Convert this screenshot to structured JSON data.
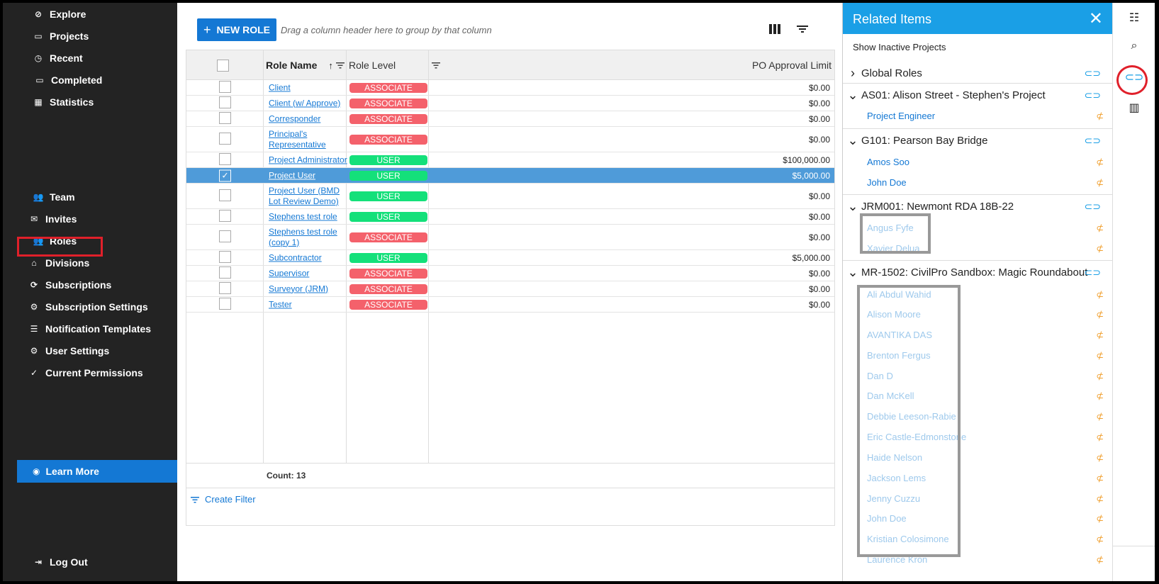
{
  "sidebar": {
    "top_items": [
      {
        "label": "Explore",
        "icon": "compass-icon"
      },
      {
        "label": "Projects",
        "icon": "folder-icon"
      },
      {
        "label": "Recent",
        "icon": "clock-icon"
      },
      {
        "label": "Completed",
        "icon": "inbox-icon"
      },
      {
        "label": "Statistics",
        "icon": "chart-icon"
      }
    ],
    "admin_items": [
      {
        "label": "Team",
        "icon": "team-icon"
      },
      {
        "label": "Invites",
        "icon": "envelope-icon"
      },
      {
        "label": "Roles",
        "icon": "roles-icon"
      },
      {
        "label": "Divisions",
        "icon": "home-icon"
      },
      {
        "label": "Subscriptions",
        "icon": "sync-icon"
      },
      {
        "label": "Subscription Settings",
        "icon": "gear-icon"
      },
      {
        "label": "Notification Templates",
        "icon": "list-icon"
      },
      {
        "label": "User Settings",
        "icon": "gear-icon"
      },
      {
        "label": "Current Permissions",
        "icon": "check-icon"
      }
    ],
    "learn_more": "Learn More",
    "log_out": "Log Out"
  },
  "toolbar": {
    "new_role": "NEW ROLE",
    "group_hint": "Drag a column header here to group by that column"
  },
  "grid": {
    "columns": {
      "role_name": "Role Name",
      "role_level": "Role Level",
      "po_limit": "PO Approval Limit"
    },
    "rows": [
      {
        "name": "Client",
        "level": "ASSOCIATE",
        "limit": "$0.00",
        "selected": false
      },
      {
        "name": "Client (w/ Approve)",
        "level": "ASSOCIATE",
        "limit": "$0.00",
        "selected": false
      },
      {
        "name": "Corresponder",
        "level": "ASSOCIATE",
        "limit": "$0.00",
        "selected": false
      },
      {
        "name": "Principal's Representative",
        "level": "ASSOCIATE",
        "limit": "$0.00",
        "selected": false
      },
      {
        "name": "Project Administrator",
        "level": "USER",
        "limit": "$100,000.00",
        "selected": false
      },
      {
        "name": "Project User",
        "level": "USER",
        "limit": "$5,000.00",
        "selected": true
      },
      {
        "name": "Project User (BMD Lot Review Demo)",
        "level": "USER",
        "limit": "$0.00",
        "selected": false
      },
      {
        "name": "Stephens test role",
        "level": "USER",
        "limit": "$0.00",
        "selected": false
      },
      {
        "name": "Stephens test role (copy 1)",
        "level": "ASSOCIATE",
        "limit": "$0.00",
        "selected": false
      },
      {
        "name": "Subcontractor",
        "level": "USER",
        "limit": "$5,000.00",
        "selected": false
      },
      {
        "name": "Supervisor",
        "level": "ASSOCIATE",
        "limit": "$0.00",
        "selected": false
      },
      {
        "name": "Surveyor (JRM)",
        "level": "ASSOCIATE",
        "limit": "$0.00",
        "selected": false
      },
      {
        "name": "Tester",
        "level": "ASSOCIATE",
        "limit": "$0.00",
        "selected": false
      }
    ],
    "count": "Count: 13",
    "create_filter": "Create Filter"
  },
  "related": {
    "title": "Related Items",
    "show_inactive": "Show Inactive Projects",
    "groups": [
      {
        "title": "Global Roles",
        "expanded": false,
        "members": []
      },
      {
        "title": "AS01: Alison Street - Stephen's Project",
        "expanded": true,
        "members": [
          "Project Engineer"
        ]
      },
      {
        "title": "G101: Pearson Bay Bridge",
        "expanded": true,
        "members": [
          "Amos Soo",
          "John Doe"
        ]
      },
      {
        "title": "JRM001: Newmont RDA 18B-22",
        "expanded": true,
        "members": [
          "Angus Fyfe",
          "Xavier Delua"
        ]
      },
      {
        "title": "MR-1502: CivilPro Sandbox: Magic Roundabout",
        "expanded": true,
        "members": [
          "Ali Abdul Wahid",
          "Alison Moore",
          "AVANTIKA DAS",
          "Brenton Fergus",
          "Dan D",
          "Dan McKell",
          "Debbie Leeson-Rabie",
          "Eric Castle-Edmonstone",
          "Haide Nelson",
          "Jackson Lems",
          "Jenny Cuzzu",
          "John Doe",
          "Kristian Colosimone",
          "Laurence Kron"
        ]
      }
    ]
  },
  "colors": {
    "sidebar_bg": "#232323",
    "accent": "#1478d4",
    "panel_header": "#1a9fe6",
    "associate": "#f4616b",
    "user": "#14e07a",
    "selected_row": "#4f9bd9"
  }
}
